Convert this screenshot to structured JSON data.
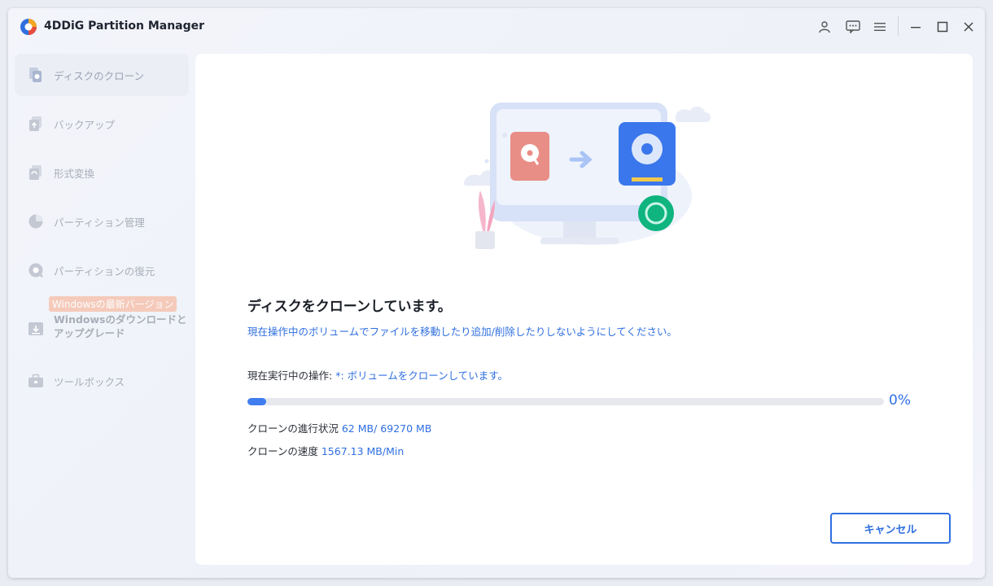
{
  "app": {
    "title": "4DDiG Partition Manager"
  },
  "titlebar": {
    "icons": [
      "account-icon",
      "feedback-icon",
      "menu-icon",
      "minimize-icon",
      "maximize-icon",
      "close-icon"
    ]
  },
  "sidebar": {
    "items": [
      {
        "label": "ディスクのクローン",
        "icon": "disk-clone-icon",
        "active": true
      },
      {
        "label": "バックアップ",
        "icon": "backup-icon"
      },
      {
        "label": "形式変換",
        "icon": "convert-icon"
      },
      {
        "label": "パーティション管理",
        "icon": "partition-pie-icon"
      },
      {
        "label": "パーティションの復元",
        "icon": "partition-recovery-icon"
      },
      {
        "label": "Windowsのダウンロードとアップグレード",
        "icon": "windows-download-icon",
        "badge": "Windowsの最新バージョン"
      },
      {
        "label": "ツールボックス",
        "icon": "toolbox-icon"
      }
    ]
  },
  "main": {
    "heading": "ディスクをクローンしています。",
    "warning": "現在操作中のボリュームでファイルを移動したり追加/削除したりしないようにしてください。",
    "current_op_label": "現在実行中の操作: ",
    "current_op_value": "*: ボリュームをクローンしています。",
    "progress_fraction": 0.03,
    "progress_text": "0%",
    "progress_label": "クローンの進行状況 ",
    "progress_value": "62 MB/ 69270 MB",
    "speed_label": "クローンの速度 ",
    "speed_value": "1567.13 MB/Min",
    "cancel_label": "キャンセル"
  },
  "colors": {
    "accent": "#2f6fe0",
    "badge": "#f6c4b0"
  }
}
